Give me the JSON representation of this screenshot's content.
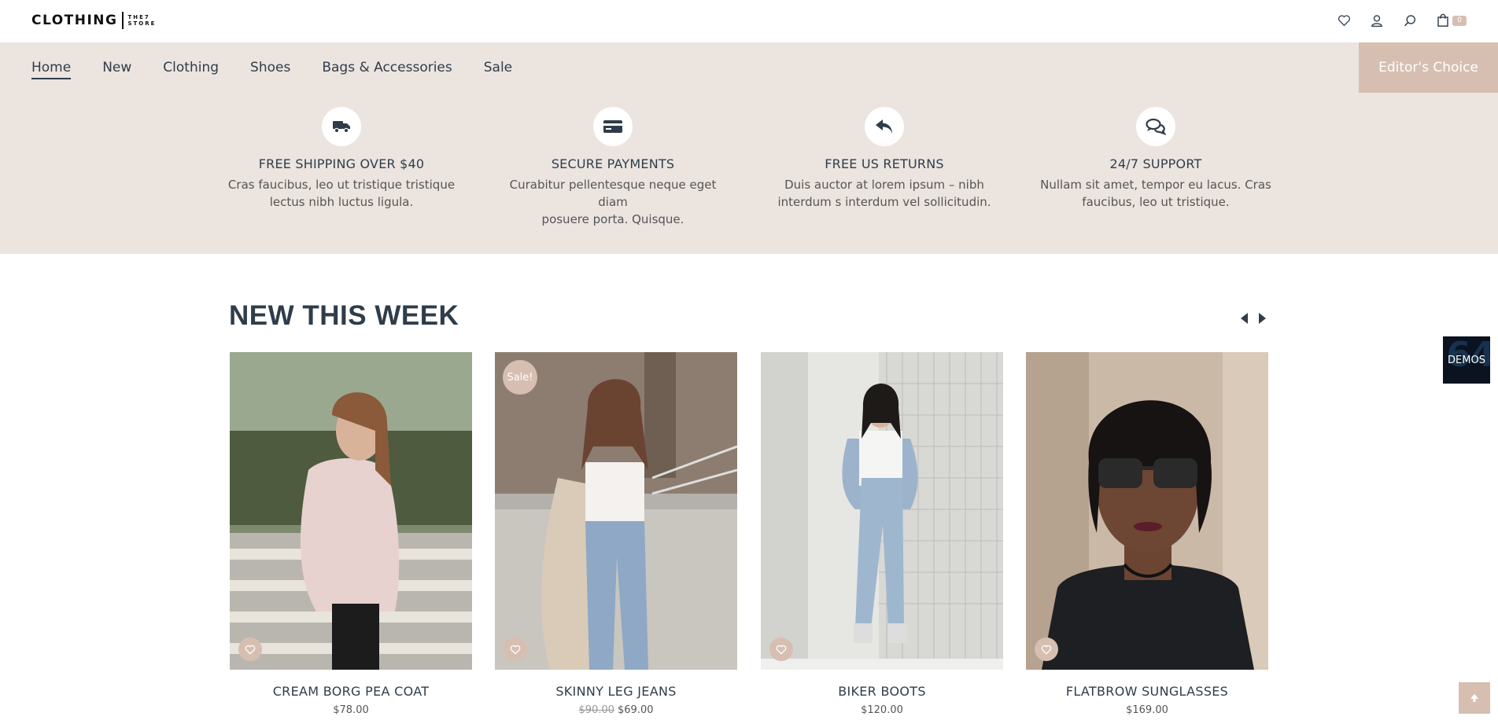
{
  "header": {
    "logo_main": "CLOTHING",
    "logo_sub_1": "THE7",
    "logo_sub_2": "STORE",
    "icons": [
      "heart-icon",
      "user-icon",
      "search-icon",
      "shopping-bag-icon"
    ],
    "cart_count": "0"
  },
  "nav": {
    "items": [
      {
        "label": "Home",
        "active": true
      },
      {
        "label": "New"
      },
      {
        "label": "Clothing"
      },
      {
        "label": "Shoes"
      },
      {
        "label": "Bags & Accessories"
      },
      {
        "label": "Sale"
      }
    ],
    "cta": "Editor's Choice"
  },
  "features": [
    {
      "icon": "truck-icon",
      "title": "FREE SHIPPING OVER $40",
      "line1": "Cras faucibus, leo ut tristique tristique",
      "line2": "lectus nibh luctus ligula."
    },
    {
      "icon": "credit-card-icon",
      "title": "SECURE PAYMENTS",
      "line1": "Curabitur pellentesque neque eget diam",
      "line2": "posuere porta. Quisque."
    },
    {
      "icon": "reply-icon",
      "title": "FREE US RETURNS",
      "line1": "Duis auctor at lorem ipsum – nibh",
      "line2": "interdum s interdum vel sollicitudin."
    },
    {
      "icon": "chat-icon",
      "title": "24/7 SUPPORT",
      "line1": "Nullam sit amet, tempor eu lacus. Cras",
      "line2": "faucibus, leo ut tristique."
    }
  ],
  "section": {
    "title": "NEW THIS WEEK"
  },
  "products": [
    {
      "name": "CREAM BORG PEA COAT",
      "price": "$78.00",
      "old_price": "",
      "sale": ""
    },
    {
      "name": "SKINNY LEG JEANS",
      "price": "$69.00",
      "old_price": "$90.00",
      "sale": "Sale!"
    },
    {
      "name": "BIKER BOOTS",
      "price": "$120.00",
      "old_price": "",
      "sale": ""
    },
    {
      "name": "FLATBROW SUNGLASSES",
      "price": "$169.00",
      "old_price": "",
      "sale": ""
    }
  ],
  "demos": {
    "label": "DEMOS",
    "bg_text": "64"
  },
  "colors": {
    "accent": "#d6bfb1",
    "band": "#ece4df",
    "text_dark": "#2f3d4a"
  }
}
